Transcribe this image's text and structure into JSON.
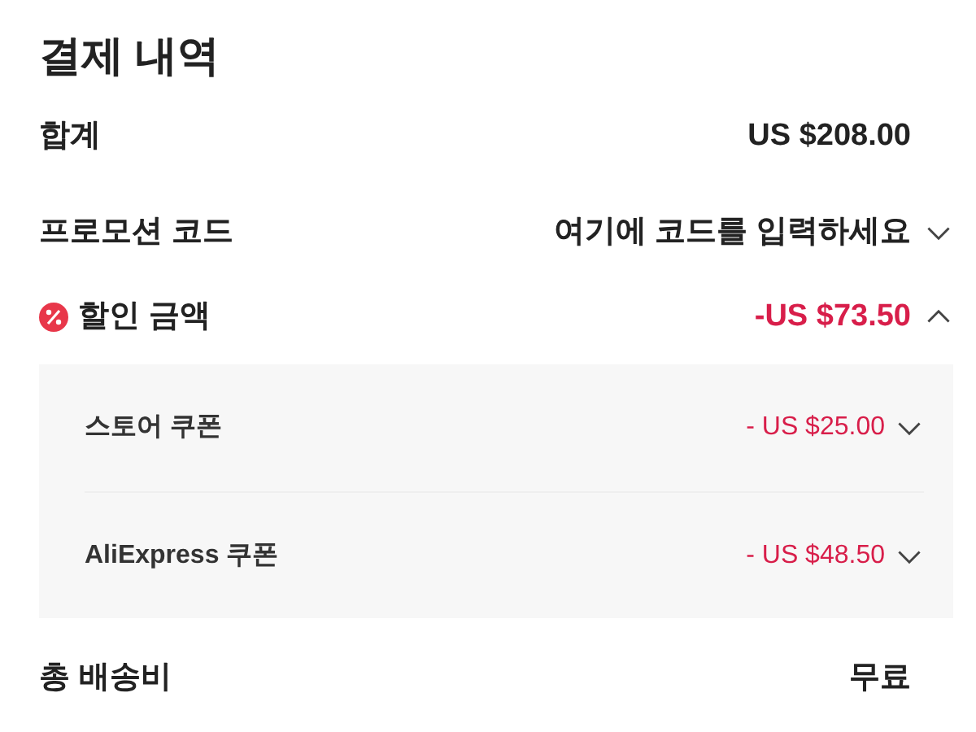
{
  "title": "결제 내역",
  "subtotal": {
    "label": "합계",
    "value": "US $208.00"
  },
  "promo_code": {
    "label": "프로모션 코드",
    "placeholder": "여기에 코드를 입력하세요",
    "expanded": false
  },
  "discount": {
    "label": "할인 금액",
    "value": "-US $73.50",
    "expanded": true,
    "items": [
      {
        "label": "스토어 쿠폰",
        "value": "- US $25.00",
        "expanded": false
      },
      {
        "label": "AliExpress 쿠폰",
        "value": "- US $48.50",
        "expanded": false
      }
    ]
  },
  "shipping": {
    "label": "총 배송비",
    "value": "무료"
  }
}
